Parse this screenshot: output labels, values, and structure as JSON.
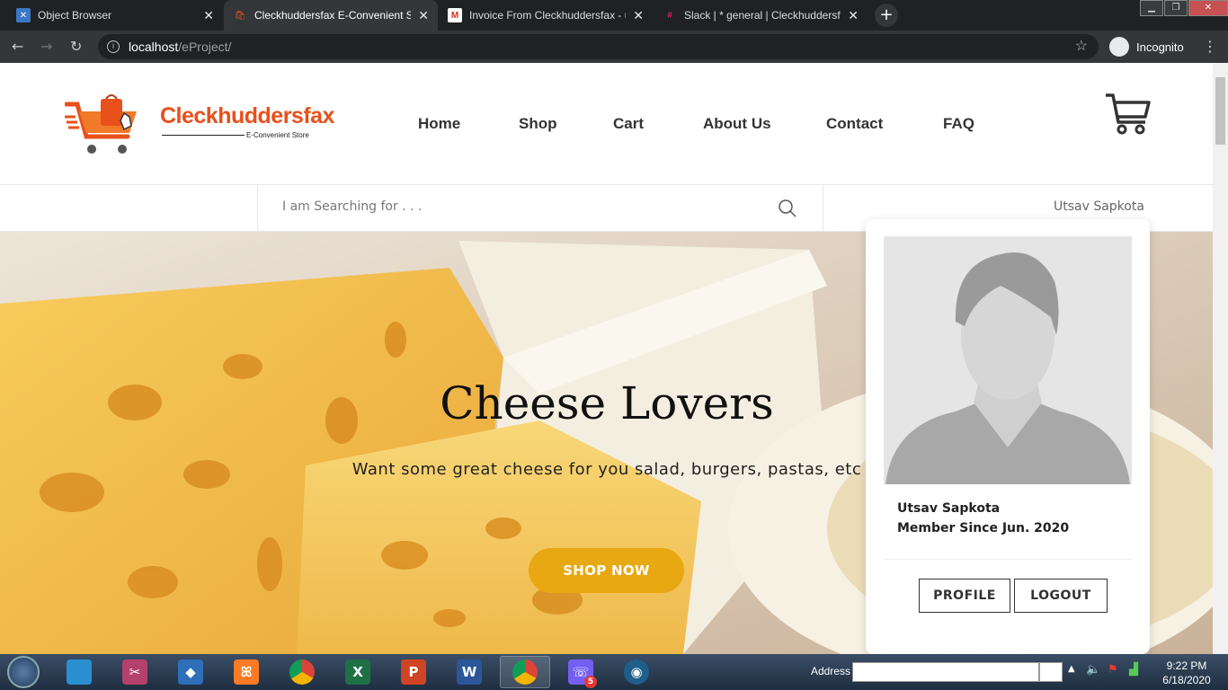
{
  "browser": {
    "tabs": [
      {
        "title": "Object Browser",
        "active": false
      },
      {
        "title": "Cleckhuddersfax E-Convenient St",
        "active": true
      },
      {
        "title": "Invoice From Cleckhuddersfax - u",
        "active": false
      },
      {
        "title": "Slack | * general | Cleckhuddersfa",
        "active": false
      }
    ],
    "url_host": "localhost",
    "url_path": "/eProject/",
    "incognito_label": "Incognito"
  },
  "site": {
    "brand": "Cleckhuddersfax",
    "tagline": "E-Convenient Store",
    "nav": [
      "Home",
      "Shop",
      "Cart",
      "About Us",
      "Contact",
      "FAQ"
    ],
    "search_placeholder": "I am Searching for . . .",
    "username": "Utsav Sapkota"
  },
  "hero": {
    "title": "Cheese Lovers",
    "subtitle": "Want some great cheese for you salad, burgers, pastas, etc",
    "button": "SHOP NOW"
  },
  "profile_popup": {
    "name": "Utsav Sapkota",
    "since": "Member Since Jun. 2020",
    "profile_button": "PROFILE",
    "logout_button": "LOGOUT"
  },
  "taskbar": {
    "address_label": "Address",
    "time": "9:22 PM",
    "date": "6/18/2020",
    "viber_badge": "5"
  },
  "colors": {
    "brand_orange": "#e8501c",
    "shop_button": "#e8a812"
  }
}
